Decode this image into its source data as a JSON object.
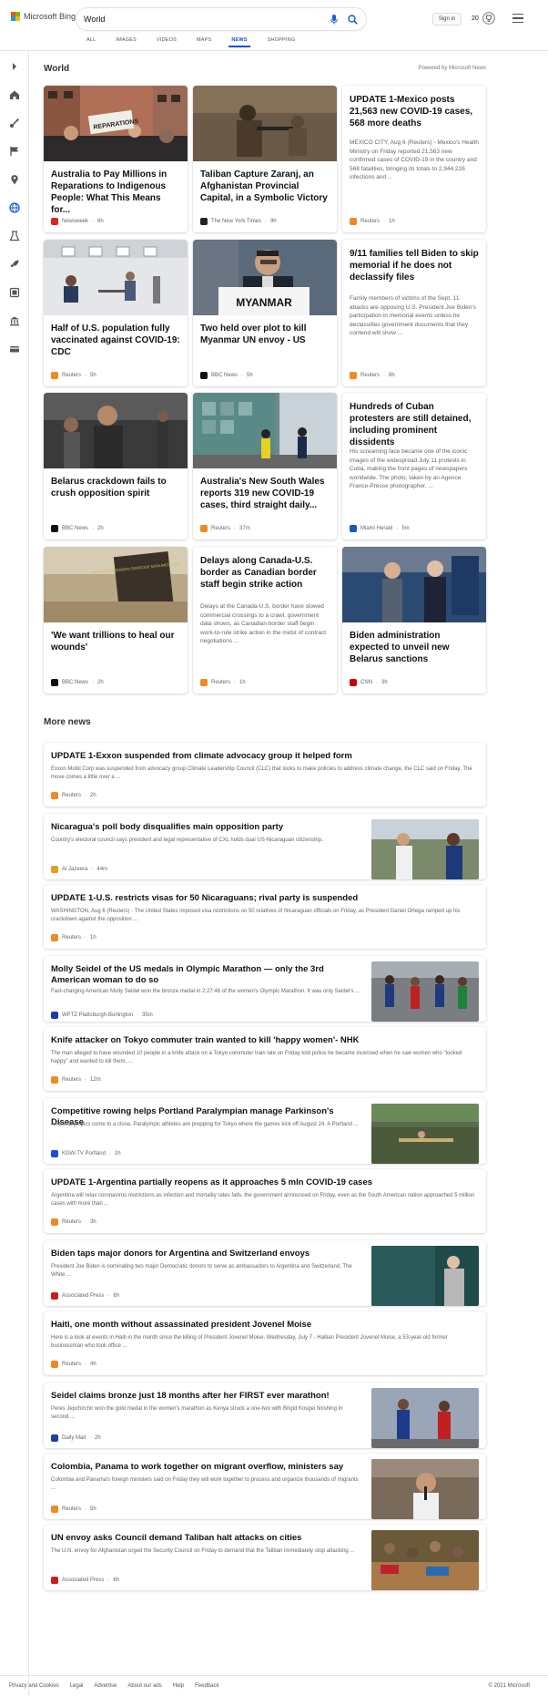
{
  "header": {
    "logo_text": "Microsoft Bing",
    "search_value": "World",
    "signin_label": "Sign in",
    "rewards_count": "20",
    "tabs": [
      {
        "label": "ALL"
      },
      {
        "label": "IMAGES"
      },
      {
        "label": "VIDEOS"
      },
      {
        "label": "MAPS"
      },
      {
        "label": "NEWS",
        "active": true
      },
      {
        "label": "SHOPPING"
      }
    ],
    "accent_color": "#174ae4"
  },
  "sidebar": {
    "icons": [
      "chevron-right-icon",
      "home-icon",
      "sports-icon",
      "flag-icon",
      "location-pin-icon",
      "globe-icon",
      "science-icon",
      "rocket-icon",
      "entertainment-icon",
      "bank-icon",
      "money-icon"
    ]
  },
  "section": {
    "title": "World",
    "powered_by": "Powered by Microsoft News"
  },
  "cards": [
    {
      "title": "Australia to Pay Millions in Reparations to Indigenous People: What This Means for...",
      "source": "Newsweek",
      "time": "6h",
      "source_color": "#d22"
    },
    {
      "title": "Taliban Capture Zaranj, an Afghanistan Provincial Capital, in a Symbolic Victory",
      "source": "The New York Times",
      "time": "9h",
      "source_color": "#222"
    },
    {
      "title": "UPDATE 1-Mexico posts 21,563 new COVID-19 cases, 568 more deaths",
      "snippet": "MEXICO CITY, Aug 6 (Reuters) - Mexico's Health Ministry on Friday reported 21,563 new confirmed cases of COVID-19 in the country and 568 fatalities, bringing its totals to 2,944,226 infections and ...",
      "source": "Reuters",
      "time": "1h",
      "source_color": "#f08a24"
    },
    {
      "title": "Half of U.S. population fully vaccinated against COVID-19: CDC",
      "source": "Reuters",
      "time": "5h",
      "source_color": "#f08a24"
    },
    {
      "title": "Two held over plot to kill Myanmar UN envoy - US",
      "source": "BBC News",
      "time": "5h",
      "source_color": "#111"
    },
    {
      "title": "9/11 families tell Biden to skip memorial if he does not declassify files",
      "snippet": "Family members of victims of the Sept. 11 attacks are opposing U.S. President Joe Biden's participation in memorial events unless he declassifies government documents that they contend will show ...",
      "source": "Reuters",
      "time": "8h",
      "source_color": "#f08a24"
    },
    {
      "title": "Belarus crackdown fails to crush opposition spirit",
      "source": "BBC News",
      "time": "2h",
      "source_color": "#111"
    },
    {
      "title": "Australia's New South Wales reports 319 new COVID-19 cases, third straight daily...",
      "source": "Reuters",
      "time": "37m",
      "source_color": "#f08a24"
    },
    {
      "title": "Hundreds of Cuban protesters are still detained, including prominent dissidents",
      "snippet": "His screaming face became one of the iconic images of the widespread July 11 protests in Cuba, making the front pages of newspapers worldwide. The photo, taken by an Agence France-Presse photographer, ...",
      "source": "Miami Herald",
      "time": "5m",
      "source_color": "#1a56c4"
    },
    {
      "title": "'We want trillions to heal our wounds'",
      "source": "BBC News",
      "time": "2h",
      "source_color": "#111"
    },
    {
      "title": "Delays along Canada-U.S. border as Canadian border staff begin strike action",
      "snippet": "Delays at the Canada-U.S. border have slowed commercial crossings to a crawl, government data shows, as Canadian border staff begin work-to-rule strike action in the midst of contract negotiations ...",
      "source": "Reuters",
      "time": "1h",
      "source_color": "#f08a24"
    },
    {
      "title": "Biden administration expected to unveil new Belarus sanctions",
      "source": "CNN",
      "time": "3h",
      "source_color": "#cc0000"
    }
  ],
  "more_news": {
    "title": "More news",
    "items": [
      {
        "title": "UPDATE 1-Exxon suspended from climate advocacy group it helped form",
        "snippet": "Exxon Mobil Corp was suspended from advocacy group Climate Leadership Council (CLC) that looks to make policies to address climate change, the CLC said on Friday. The move comes a little over a ...",
        "source": "Reuters",
        "time": "2h",
        "source_color": "#f08a24"
      },
      {
        "title": "Nicaragua's poll body disqualifies main opposition party",
        "snippet": "Country's electoral council says president and legal representative of CXL holds dual US-Nicaraguan citizenship.",
        "source": "Al Jazeera",
        "time": "44m",
        "source_color": "#e0a020"
      },
      {
        "title": "UPDATE 1-U.S. restricts visas for 50 Nicaraguans; rival party is suspended",
        "snippet": "WASHINGTON, Aug 6 (Reuters) - The United States imposed visa restrictions on 50 relatives of Nicaraguan officials on Friday, as President Daniel Ortega ramped up his crackdown against the opposition ...",
        "source": "Reuters",
        "time": "1h",
        "source_color": "#f08a24"
      },
      {
        "title": "Molly Seidel of the US medals in Olympic Marathon — only the 3rd American woman to do so",
        "snippet": "Fast-charging American Molly Seidel won the bronze medal in 2:27:46 of the women's Olympic Marathon. It was only Seidel's ...",
        "source": "WPTZ Plattsburgh-Burlington",
        "time": "35m",
        "source_color": "#1c3aa8"
      },
      {
        "title": "Knife attacker on Tokyo commuter train wanted to kill 'happy women'- NHK",
        "snippet": "The man alleged to have wounded 10 people in a knife attack on a Tokyo commuter train late on Friday told police he became incensed when he saw women who \"looked happy\" and wanted to kill them, ...",
        "source": "Reuters",
        "time": "12m",
        "source_color": "#f08a24"
      },
      {
        "title": "Competitive rowing helps Portland Paralympian manage Parkinson's Disease",
        "snippet": "As the Olympics come to a close, Paralympic athletes are prepping for Tokyo where the games kick off August 24. A Portland ...",
        "source": "KGW-TV Portland",
        "time": "1h",
        "source_color": "#1e4bd8"
      },
      {
        "title": "UPDATE 1-Argentina partially reopens as it approaches 5 mln COVID-19 cases",
        "snippet": "Argentina will relax coronavirus restrictions as infection and mortality rates falls, the government announced on Friday, even as the South American nation approached 5 million cases with more than ...",
        "source": "Reuters",
        "time": "3h",
        "source_color": "#f08a24"
      },
      {
        "title": "Biden taps major donors for Argentina and Switzerland envoys",
        "snippet": "President Joe Biden is nominating two major Democratic donors to serve as ambassadors to Argentina and Switzerland. The White ...",
        "source": "Associated Press",
        "time": "6h",
        "source_color": "#c81e1e"
      },
      {
        "title": "Haiti, one month without assassinated president Jovenel Moise",
        "snippet": "Here is a look at events in Haiti in the month since the killing of President Jovenel Moise. Wednesday, July 7 - Haitian President Jovenel Moise, a 53-year-old former businessman who took office ...",
        "source": "Reuters",
        "time": "4h",
        "source_color": "#f08a24"
      },
      {
        "title": "Seidel claims bronze just 18 months after her FIRST ever marathon!",
        "snippet": "Peres Jepchirchir won the gold medal in the women's marathon as Kenya struck a one-two with Brigid Kosgei finishing in second ...",
        "source": "Daily Mail",
        "time": "2h",
        "source_color": "#1f3f9a"
      },
      {
        "title": "Colombia, Panama to work together on migrant overflow, ministers say",
        "snippet": "Colombia and Panama's foreign ministers said on Friday they will work together to process and organize thousands of migrants ...",
        "source": "Reuters",
        "time": "5h",
        "source_color": "#f08a24"
      },
      {
        "title": "UN envoy asks Council demand Taliban halt attacks on cities",
        "snippet": "The U.N. envoy for Afghanistan urged the Security Council on Friday to demand that the Taliban immediately stop attacking ...",
        "source": "Associated Press",
        "time": "6h",
        "source_color": "#c81e1e"
      }
    ]
  },
  "image_text": {
    "myanmar_nameplate": "MYANMAR",
    "protest_sign": "REPARATIONS",
    "monument_plaque": "NAMA & OVAHERERO GENOCIDE MONUMENT 1904 - 1908"
  },
  "footer": {
    "links": [
      "Privacy and Cookies",
      "Legal",
      "Advertise",
      "About our ads",
      "Help",
      "Feedback"
    ],
    "copyright": "© 2021 Microsoft"
  }
}
